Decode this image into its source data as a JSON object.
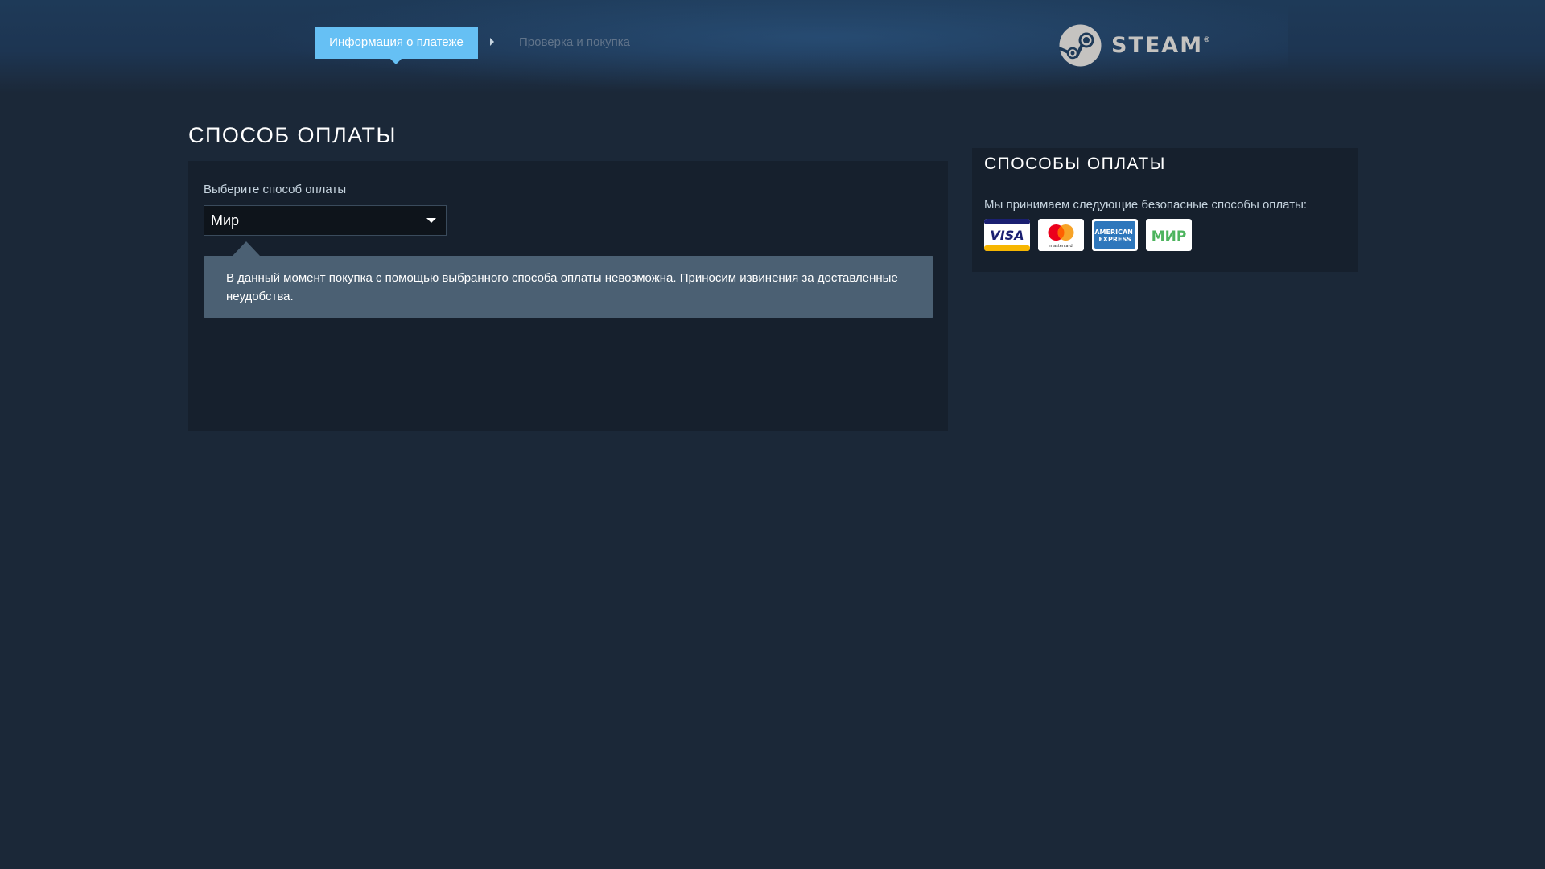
{
  "checkout_steps": {
    "active_step": "Информация о платеже",
    "next_step": "Проверка и покупка"
  },
  "brand": {
    "logo_text": "STEAM",
    "logo_mark": "®"
  },
  "payment_section": {
    "title": "СПОСОБ ОПЛАТЫ",
    "select_label": "Выберите способ оплаты",
    "selected_method": "Мир",
    "notice": "В данный момент покупка с помощью выбранного способа оплаты невозможна. Приносим извинения за доставленные неудобства."
  },
  "methods_sidebar": {
    "title": "СПОСОБЫ ОПЛАТЫ",
    "description": "Мы принимаем следующие безопасные способы оплаты:",
    "cards": [
      {
        "name": "visa-card-icon",
        "label": "VISA"
      },
      {
        "name": "mastercard-card-icon",
        "label": "mastercard"
      },
      {
        "name": "amex-card-icon",
        "label": "AMERICAN EXPRESS"
      },
      {
        "name": "mir-card-icon",
        "label": "МИР"
      }
    ]
  },
  "colors": {
    "page_bg": "#1b2838",
    "panel_bg": "#16202d",
    "accent": "#66c0f4",
    "notice_bg": "#4b6073"
  }
}
